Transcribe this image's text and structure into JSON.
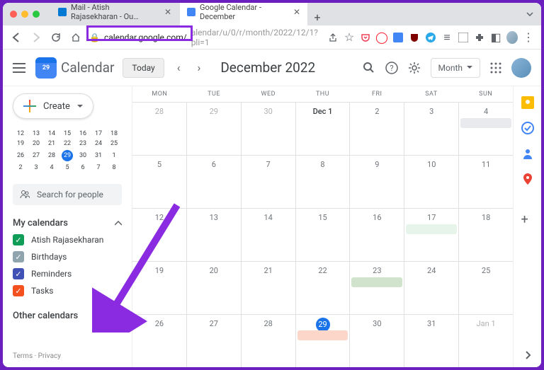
{
  "browser": {
    "tabs": [
      {
        "title": "Mail - Atish Rajasekharan - Ou…"
      },
      {
        "title": "Google Calendar - December"
      }
    ],
    "url_host": "calendar.google.com/",
    "url_path": "alendar/u/0/r/month/2022/12/1?pli=1"
  },
  "appbar": {
    "logo_day": "29",
    "product": "Calendar",
    "today": "Today",
    "title": "December 2022",
    "view": "Month"
  },
  "sidebar": {
    "create": "Create",
    "search_placeholder": "Search for people",
    "my_calendars": "My calendars",
    "other_calendars": "Other calendars",
    "calendars": [
      {
        "name": "Atish Rajasekharan",
        "color": "#0f9d58"
      },
      {
        "name": "Birthdays",
        "color": "#90a4ae"
      },
      {
        "name": "Reminders",
        "color": "#3f51b5"
      },
      {
        "name": "Tasks",
        "color": "#f4511e"
      }
    ],
    "footer": "Terms  ·  Privacy"
  },
  "minical": {
    "rows": [
      [
        "12",
        "13",
        "14",
        "15",
        "16",
        "17",
        "18"
      ],
      [
        "19",
        "20",
        "21",
        "22",
        "23",
        "24",
        "25"
      ],
      [
        "26",
        "27",
        "28",
        "29",
        "30",
        "31",
        "1"
      ],
      [
        "2",
        "3",
        "4",
        "5",
        "6",
        "7",
        "8"
      ]
    ],
    "today": "29"
  },
  "grid": {
    "daynames": [
      "MON",
      "TUE",
      "WED",
      "THU",
      "FRI",
      "SAT",
      "SUN"
    ],
    "weeks": [
      [
        {
          "n": "28",
          "o": true
        },
        {
          "n": "29",
          "o": true
        },
        {
          "n": "30",
          "o": true
        },
        {
          "n": "Dec 1",
          "b": true
        },
        {
          "n": "2"
        },
        {
          "n": "3"
        },
        {
          "n": "4",
          "ev": "#e8eaed"
        }
      ],
      [
        {
          "n": "5"
        },
        {
          "n": "6"
        },
        {
          "n": "7"
        },
        {
          "n": "8"
        },
        {
          "n": "9"
        },
        {
          "n": "10"
        },
        {
          "n": "11"
        }
      ],
      [
        {
          "n": "12"
        },
        {
          "n": "13"
        },
        {
          "n": "14"
        },
        {
          "n": "15"
        },
        {
          "n": "16"
        },
        {
          "n": "17",
          "ev": "#e6f4ea"
        },
        {
          "n": "18"
        }
      ],
      [
        {
          "n": "19"
        },
        {
          "n": "20"
        },
        {
          "n": "21"
        },
        {
          "n": "22"
        },
        {
          "n": "23",
          "ev": "#d2e3cd"
        },
        {
          "n": "24"
        },
        {
          "n": "25"
        }
      ],
      [
        {
          "n": "26"
        },
        {
          "n": "27"
        },
        {
          "n": "28"
        },
        {
          "n": "29",
          "t": true,
          "ev": "#fbd6c9"
        },
        {
          "n": "30"
        },
        {
          "n": "31"
        },
        {
          "n": "Jan 1",
          "o": true
        }
      ]
    ],
    "current_date": "29"
  }
}
